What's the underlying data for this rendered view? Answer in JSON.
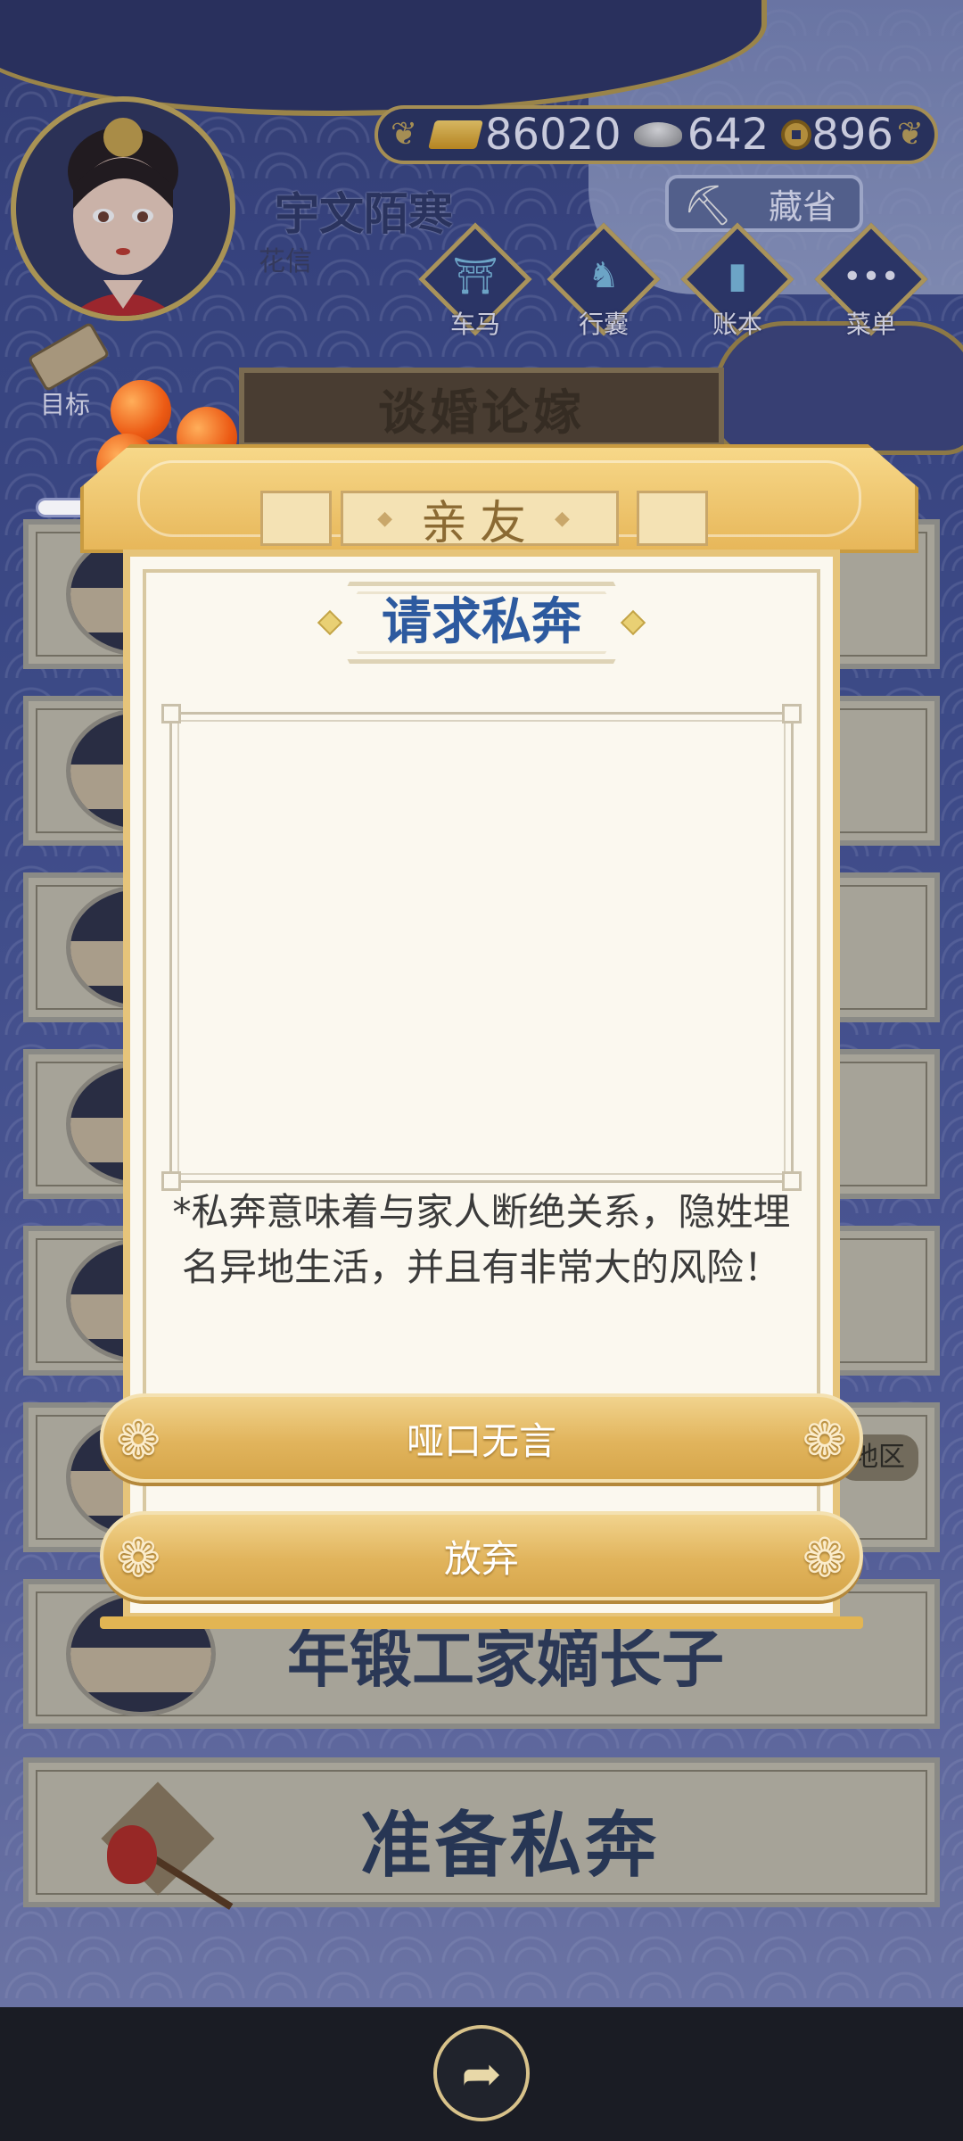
{
  "header": {
    "player_name": "宇文陌寒",
    "player_sub": "花信",
    "currencies": [
      {
        "icon": "gold-ingot-icon",
        "value": "86020"
      },
      {
        "icon": "silver-ingot-icon",
        "value": "642"
      },
      {
        "icon": "copper-coin-icon",
        "value": "896"
      }
    ],
    "hide_button": "藏省",
    "nav": [
      {
        "label": "车马",
        "icon": "carriage-icon",
        "glyph": "⛩"
      },
      {
        "label": "行囊",
        "icon": "bag-icon",
        "glyph": "♞"
      },
      {
        "label": "账本",
        "icon": "ledger-icon",
        "glyph": "▮"
      },
      {
        "label": "菜单",
        "icon": "menu-icon",
        "glyph": "•••"
      }
    ],
    "target_label": "目标"
  },
  "background_list": {
    "title": "谈婚论嫁",
    "visible_card_text": "年锻工家嫡长子",
    "region_tag": "地区",
    "elope_button": "准备私奔"
  },
  "modal": {
    "tab_label": "亲友",
    "title": "请求私奔",
    "note": "*私奔意味着与家人断绝关系，隐姓埋名异地生活，并且有非常大的风险！",
    "buttons": {
      "mute": "哑口无言",
      "give_up": "放弃"
    }
  },
  "colors": {
    "accent_gold": "#e1b45c",
    "title_blue": "#2d5a9f",
    "bg_indigo": "#46559a"
  }
}
